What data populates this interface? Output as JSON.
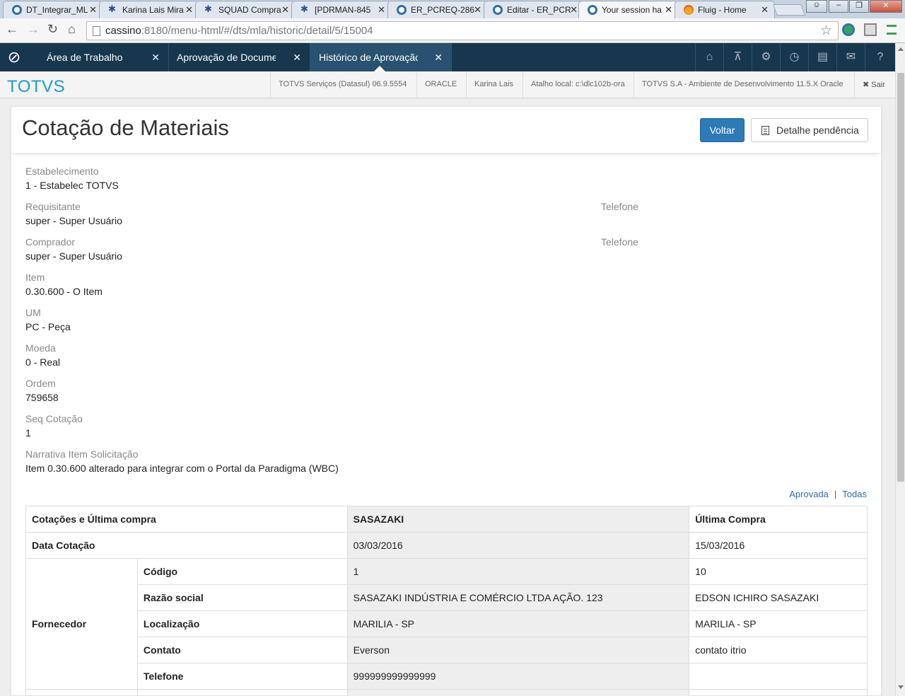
{
  "browser": {
    "tabs": [
      {
        "title": "DT_Integrar_ML",
        "icon": "globe-icon",
        "active": false
      },
      {
        "title": "Karina Lais Mira",
        "icon": "bug-icon",
        "active": false
      },
      {
        "title": "SQUAD Compra",
        "icon": "bug-icon",
        "active": false
      },
      {
        "title": "[PDRMAN-845",
        "icon": "bug-icon",
        "active": false
      },
      {
        "title": "ER_PCREQ-286",
        "icon": "globe-icon",
        "active": false
      },
      {
        "title": "Editar - ER_PCR",
        "icon": "globe-icon",
        "active": false
      },
      {
        "title": "Your session ha",
        "icon": "globe-icon",
        "active": true
      },
      {
        "title": "Fluig - Home",
        "icon": "fire-icon",
        "active": false
      }
    ],
    "url_host": "cassino",
    "url_rest": ":8180/menu-html/#/dts/mla/historic/detail/5/15004"
  },
  "app": {
    "tabs": [
      {
        "label": "Área de Trabalho",
        "active": false
      },
      {
        "label": "Aprovação de Docume",
        "active": false
      },
      {
        "label": "Histórico de Aprovação",
        "active": true
      }
    ],
    "toolbar_icons": [
      "home-icon",
      "sitemap-icon",
      "gear-icon",
      "clock-icon",
      "document-icon",
      "mail-icon",
      "help-icon"
    ],
    "brand": "TOTVS",
    "info": [
      "TOTVS Serviços (Datasul) 06.9.5554",
      "ORACLE",
      "Karina Lais",
      "Atalho local: c:\\dlc102b-ora",
      "TOTVS S.A - Ambiente de Desenvolvimento 11.5.X Oracle"
    ],
    "logout": "Sair"
  },
  "page": {
    "title": "Cotação de Materiais",
    "back_button": "Voltar",
    "detail_button": "Detalhe pendência",
    "fields": {
      "estabelecimento": {
        "label": "Estabelecimento",
        "value": "1 - Estabelec TOTVS"
      },
      "requisitante": {
        "label": "Requisitante",
        "value": "super - Super Usuário"
      },
      "requisitante_tel": {
        "label": "Telefone",
        "value": ""
      },
      "comprador": {
        "label": "Comprador",
        "value": "super - Super Usuário"
      },
      "comprador_tel": {
        "label": "Telefone",
        "value": ""
      },
      "item": {
        "label": "Item",
        "value": "0.30.600 - O Item"
      },
      "um": {
        "label": "UM",
        "value": "PC - Peça"
      },
      "moeda": {
        "label": "Moeda",
        "value": "0 - Real"
      },
      "ordem": {
        "label": "Ordem",
        "value": "759658"
      },
      "seq": {
        "label": "Seq Cotação",
        "value": "1"
      },
      "narrativa": {
        "label": "Narrativa Item Solicitação",
        "value": "Item 0.30.600 alterado para integrar com o Portal da Paradigma (WBC)"
      }
    },
    "filters": {
      "approved": "Aprovada",
      "separator": "|",
      "all": "Todas"
    },
    "table": {
      "header": {
        "col1": "Cotações e Última compra",
        "col2": "SASAZAKI",
        "col3": "Última Compra"
      },
      "data_cotacao": {
        "label": "Data Cotação",
        "v1": "03/03/2016",
        "v2": "15/03/2016"
      },
      "fornecedor_label": "Fornecedor",
      "fornecedor_rows": [
        {
          "label": "Código",
          "v1": "1",
          "v2": "10"
        },
        {
          "label": "Razão social",
          "v1": "SASAZAKI INDÚSTRIA E COMÉRCIO LTDA AÇÃO. 123",
          "v2": "EDSON ICHIRO SASAZAKI"
        },
        {
          "label": "Localização",
          "v1": "MARILIA - SP",
          "v2": "MARILIA - SP"
        },
        {
          "label": "Contato",
          "v1": "Everson",
          "v2": "contato itrio"
        },
        {
          "label": "Telefone",
          "v1": "999999999999999",
          "v2": ""
        }
      ]
    }
  }
}
